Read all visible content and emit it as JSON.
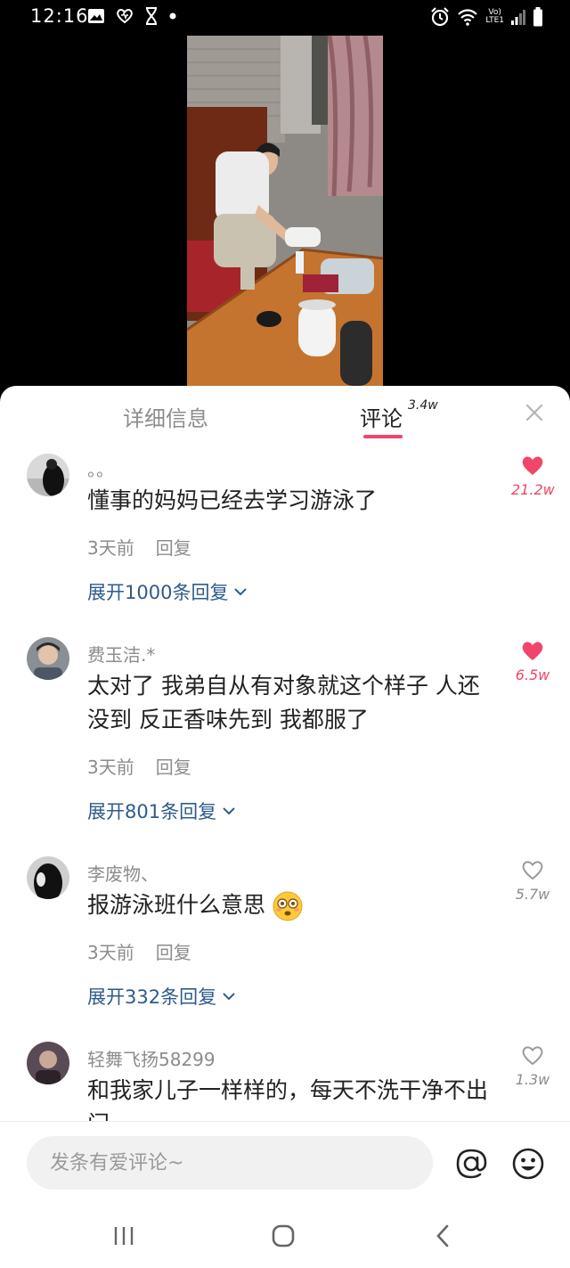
{
  "status_bar": {
    "time": "12:16",
    "left_icons": [
      "image-icon",
      "heart-notification-icon",
      "hourglass-icon",
      "dot-icon"
    ],
    "right_icons": [
      "alarm-icon",
      "wifi-icon",
      "volte-lte-icon",
      "signal-icon",
      "battery-icon"
    ],
    "network_top": "Vo)",
    "network_bottom": "LTE1"
  },
  "tabs": {
    "details_label": "详细信息",
    "comments_label": "评论",
    "comments_count": "3.4w"
  },
  "comments": [
    {
      "user": "。。",
      "text": "懂事的妈妈已经去学习游泳了",
      "time": "3天前",
      "reply_label": "回复",
      "expand_label": "展开1000条回复",
      "likes": "21.2w",
      "liked": true
    },
    {
      "user": "费玉洁.*",
      "text": "太对了 我弟自从有对象就这个样子 人还没到 反正香味先到 我都服了",
      "time": "3天前",
      "reply_label": "回复",
      "expand_label": "展开801条回复",
      "likes": "6.5w",
      "liked": true
    },
    {
      "user": "李废物、",
      "text": "报游泳班什么意思",
      "time": "3天前",
      "reply_label": "回复",
      "expand_label": "展开332条回复",
      "likes": "5.7w",
      "liked": false
    },
    {
      "user": "轻舞飞扬58299",
      "text": "和我家儿子一样样的，每天不洗干净不出门",
      "likes": "1.3w",
      "liked": false
    }
  ],
  "input": {
    "placeholder": "发条有爱评论~"
  },
  "colors": {
    "accent": "#f0466a",
    "link": "#2e5b8c",
    "muted": "#8c8c8c"
  }
}
